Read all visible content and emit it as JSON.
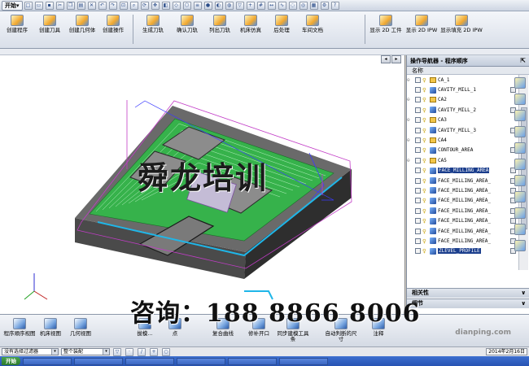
{
  "titlebar": {
    "start_label": "开始"
  },
  "ribbon": {
    "buttons": [
      {
        "label": "创建程序"
      },
      {
        "label": "创建刀具"
      },
      {
        "label": "创建几何体"
      },
      {
        "label": "创建操作"
      },
      {
        "label": "生成刀轨"
      },
      {
        "label": "确认刀轨"
      },
      {
        "label": "列出刀轨"
      },
      {
        "label": "机床仿真"
      },
      {
        "label": "后处理"
      },
      {
        "label": "车间文档"
      },
      {
        "label": "显示 2D 工件"
      },
      {
        "label": "显示 2D IPW"
      },
      {
        "label": "显示填充 2D IPW"
      }
    ]
  },
  "viewport": {
    "watermark": "舜龙培训"
  },
  "navigator": {
    "title": "操作导航器 - 程序顺序",
    "column_header": "名称",
    "rows": [
      {
        "label": "CA_1",
        "kind": "group"
      },
      {
        "label": "CAVITY_MILL_1",
        "kind": "op"
      },
      {
        "label": "CA2",
        "kind": "group"
      },
      {
        "label": "CAVITY_MILL_2",
        "kind": "op"
      },
      {
        "label": "CA3",
        "kind": "group"
      },
      {
        "label": "CAVITY_MILL_3",
        "kind": "op"
      },
      {
        "label": "CA4",
        "kind": "group"
      },
      {
        "label": "CONTOUR_AREA",
        "kind": "op"
      },
      {
        "label": "CA5",
        "kind": "group"
      },
      {
        "label": "FACE_MILLING_AREA",
        "kind": "op",
        "selected": true
      },
      {
        "label": "FACE_MILLING_AREA_",
        "kind": "op"
      },
      {
        "label": "FACE_MILLING_AREA_",
        "kind": "op"
      },
      {
        "label": "FACE_MILLING_AREA_",
        "kind": "op"
      },
      {
        "label": "FACE_MILLING_AREA_",
        "kind": "op"
      },
      {
        "label": "FACE_MILLING_AREA_",
        "kind": "op"
      },
      {
        "label": "FACE_MILLING_AREA_",
        "kind": "op"
      },
      {
        "label": "FACE_MILLING_AREA_",
        "kind": "op"
      },
      {
        "label": "ZLEVEL_PROFILE",
        "kind": "op",
        "selected": true
      }
    ],
    "panel_related": "相关性",
    "panel_details": "细节"
  },
  "bottombar": {
    "buttons": [
      {
        "label": "程序顺序视图"
      },
      {
        "label": "机床视图"
      },
      {
        "label": "几何视图"
      },
      {
        "label": "拔模..."
      },
      {
        "label": "点"
      },
      {
        "label": "复合曲线"
      },
      {
        "label": "修补开口"
      },
      {
        "label": "同步建模工具条"
      },
      {
        "label": "自动判断的尺寸"
      },
      {
        "label": "注释"
      }
    ],
    "overlay_phone": "咨询：188 8866 8006"
  },
  "selbar": {
    "filter": "没有选择过滤器",
    "assembly": "整个装配",
    "date": "2014年2月16日"
  },
  "taskbar": {
    "start": "开始",
    "items": [
      "",
      "",
      "",
      "",
      "",
      ""
    ]
  },
  "watermark_site": "dianping.com",
  "colors": {
    "accent": "#1a3d8c",
    "tool_green": "#2fa33b",
    "model_dark": "#3c3c3c"
  }
}
